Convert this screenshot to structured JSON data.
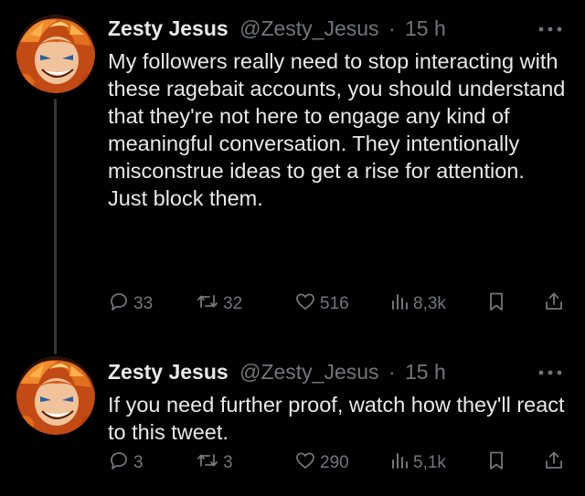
{
  "tweets": [
    {
      "author_name": "Zesty Jesus",
      "handle": "@Zesty_Jesus",
      "separator": "·",
      "time": "15 h",
      "text": "My followers really need to stop interacting with these ragebait accounts, you should understand that they're not here to engage any kind of meaningful conversation. They intentionally misconstrue ideas to get a rise for attention. Just block them.",
      "replies": "33",
      "retweets": "32",
      "likes": "516",
      "views": "8,3k"
    },
    {
      "author_name": "Zesty Jesus",
      "handle": "@Zesty_Jesus",
      "separator": "·",
      "time": "15 h",
      "text": "If you need further proof, watch how they'll react to this tweet.",
      "replies": "3",
      "retweets": "3",
      "likes": "290",
      "views": "5,1k"
    }
  ],
  "icons": {
    "reply": "speech-bubble-icon",
    "retweet": "retweet-arrows-icon",
    "like": "heart-icon",
    "views": "bar-chart-icon",
    "bookmark": "bookmark-icon",
    "share": "share-upload-icon",
    "more": "more-dots-icon"
  },
  "colors": {
    "background": "#000000",
    "text": "#e7e9ea",
    "secondary": "#71767b",
    "thread_line": "#333639"
  }
}
